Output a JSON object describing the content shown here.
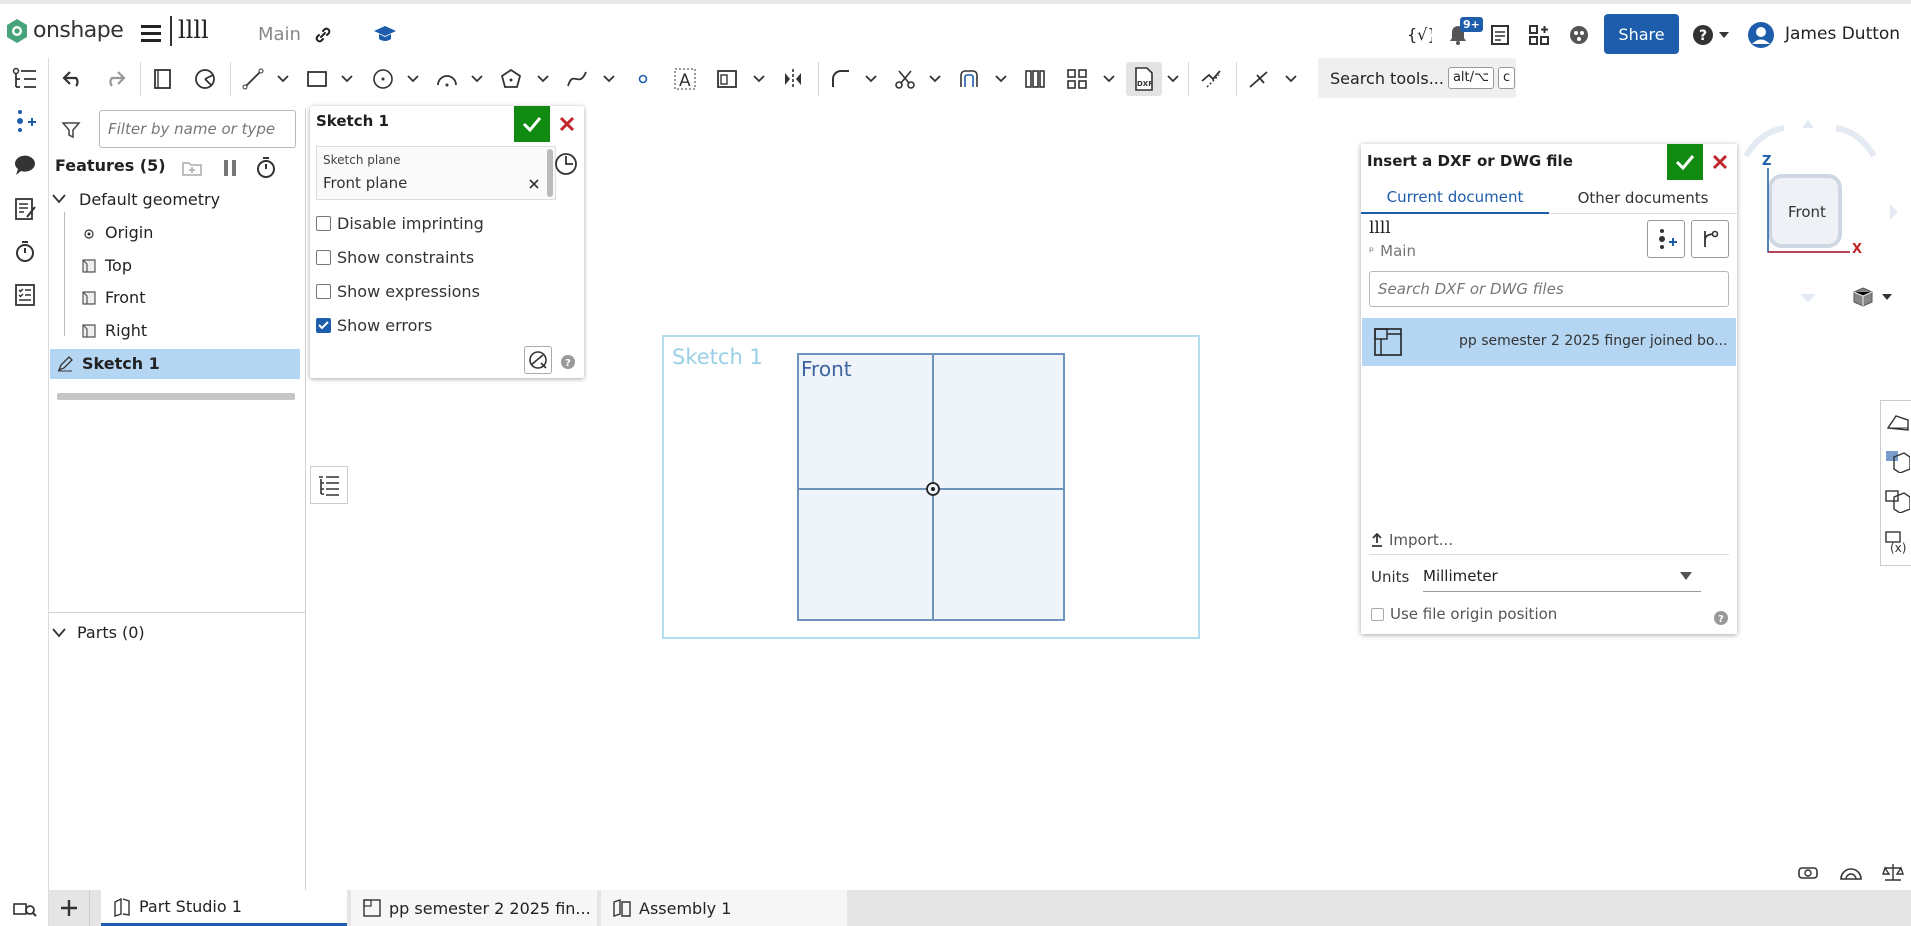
{
  "header": {
    "logo_text": "onshape",
    "doc_name": "llll",
    "branch": "Main",
    "notif_badge": "9+",
    "share_label": "Share",
    "user_name": "James Dutton"
  },
  "toolbar": {
    "search_label": "Search tools...",
    "kbd1": "alt/⌥",
    "kbd2": "c"
  },
  "features": {
    "filter_placeholder": "Filter by name or type",
    "title": "Features (5)",
    "default_geometry": "Default geometry",
    "origin": "Origin",
    "top": "Top",
    "front": "Front",
    "right": "Right",
    "sketch": "Sketch 1",
    "parts": "Parts (0)"
  },
  "sketch_dialog": {
    "title": "Sketch 1",
    "plane_label": "Sketch plane",
    "plane_value": "Front plane",
    "options": [
      {
        "label": "Disable imprinting",
        "checked": false
      },
      {
        "label": "Show constraints",
        "checked": false
      },
      {
        "label": "Show expressions",
        "checked": false
      },
      {
        "label": "Show errors",
        "checked": true
      }
    ]
  },
  "viewport": {
    "sketch_label": "Sketch 1",
    "plane_label": "Front"
  },
  "insert_dialog": {
    "title": "Insert a DXF or DWG file",
    "tab_current": "Current document",
    "tab_other": "Other documents",
    "doc_name": "llll",
    "branch": "Main",
    "search_placeholder": "Search DXF or DWG files",
    "file_item": "pp semester 2 2025 finger joined bo...",
    "import_label": "Import...",
    "units_label": "Units",
    "units_value": "Millimeter",
    "origin_label": "Use file origin position"
  },
  "view_cube": {
    "face": "Front",
    "axis_z": "Z",
    "axis_x": "X"
  },
  "bottom_tabs": [
    {
      "label": "Part Studio 1"
    },
    {
      "label": "pp semester 2 2025 fin..."
    },
    {
      "label": "Assembly 1"
    }
  ],
  "colors": {
    "accent": "#1d5dab",
    "ok_green": "#108a10",
    "cancel_red": "#c0272d",
    "selection": "#b5d6f3"
  }
}
